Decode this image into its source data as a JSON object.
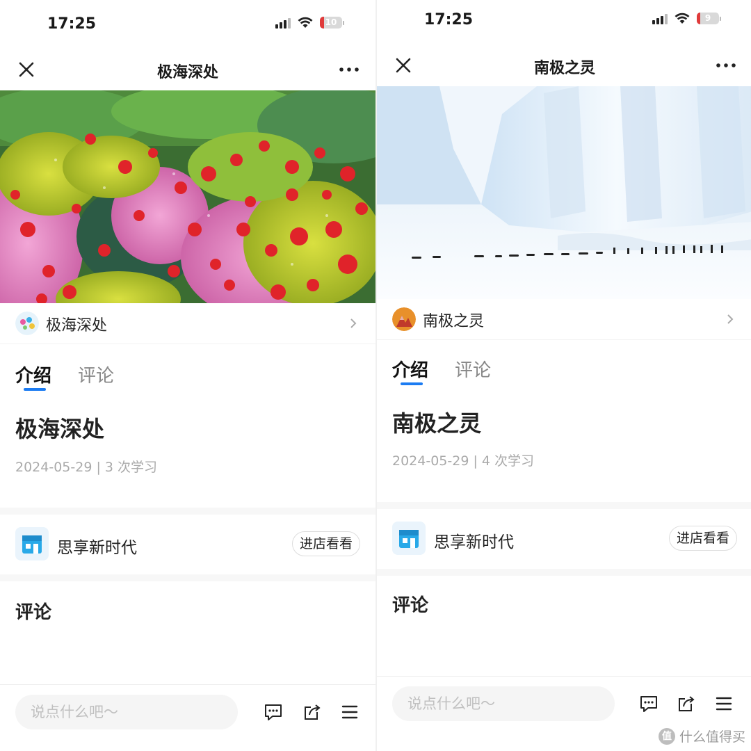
{
  "screens": [
    {
      "status": {
        "time": "17:25",
        "battery": "10"
      },
      "nav": {
        "title": "极海深处"
      },
      "author": {
        "name": "极海深处"
      },
      "tabs": [
        "介绍",
        "评论"
      ],
      "article": {
        "title": "极海深处",
        "meta": "2024-05-29 | 3 次学习"
      },
      "shop": {
        "name": "思享新时代",
        "button": "进店看看"
      },
      "comments_heading": "评论",
      "bottom": {
        "placeholder": "说点什么吧～"
      }
    },
    {
      "status": {
        "time": "17:25",
        "battery": "9"
      },
      "nav": {
        "title": "南极之灵"
      },
      "author": {
        "name": "南极之灵"
      },
      "tabs": [
        "介绍",
        "评论"
      ],
      "article": {
        "title": "南极之灵",
        "meta": "2024-05-29 | 4 次学习"
      },
      "shop": {
        "name": "思享新时代",
        "button": "进店看看"
      },
      "comments_heading": "评论",
      "bottom": {
        "placeholder": "说点什么吧～"
      }
    }
  ],
  "watermark": {
    "text": "什么值得买",
    "logo": "值"
  },
  "colors": {
    "accent": "#1c7cf2",
    "battery_low": "#e03a3a",
    "shop_icon": "#29a9e8"
  },
  "icons": [
    "close-icon",
    "more-icon",
    "chevron-right-icon",
    "comment-icon",
    "share-icon",
    "menu-icon",
    "shop-icon",
    "wifi-icon",
    "signal-icon",
    "battery-icon"
  ]
}
